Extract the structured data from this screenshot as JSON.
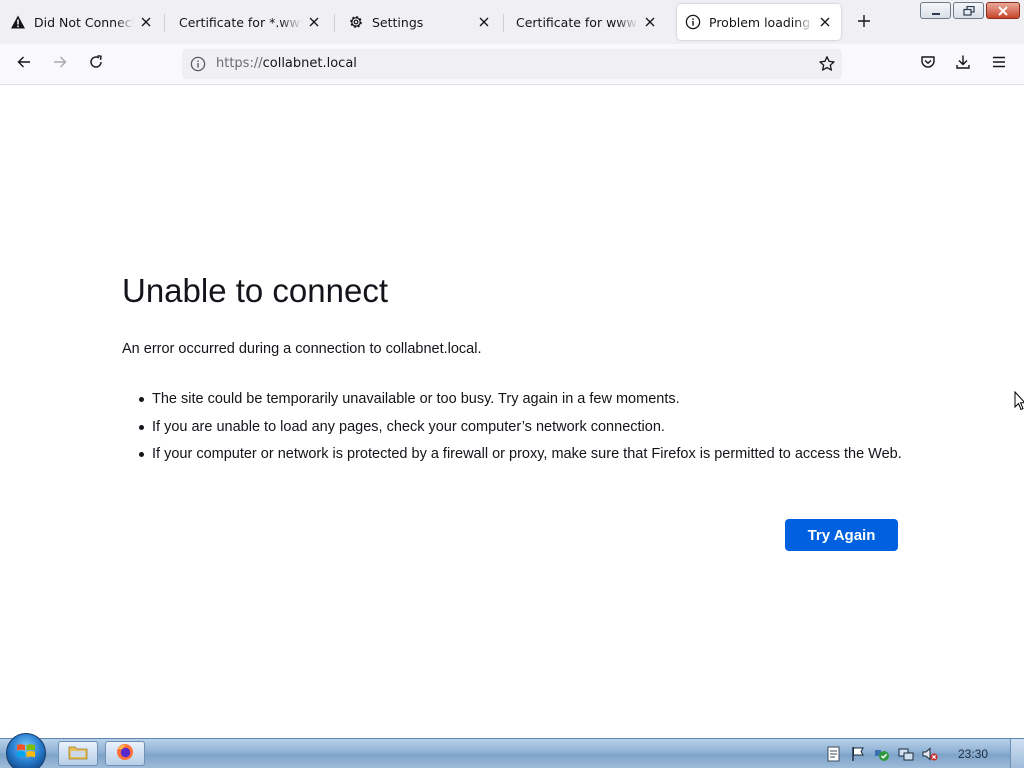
{
  "tabs": [
    {
      "title": "Did Not Connect: Potential Security Issue",
      "icon": "warning-icon",
      "active": false
    },
    {
      "title": "Certificate for *.www.mozilla.org",
      "icon": "none",
      "active": false
    },
    {
      "title": "Settings",
      "icon": "gear-icon",
      "active": false
    },
    {
      "title": "Certificate for www.google.com",
      "icon": "none",
      "active": false
    },
    {
      "title": "Problem loading page",
      "icon": "info-icon",
      "active": true
    }
  ],
  "urlbar": {
    "scheme": "https://",
    "host": "collabnet.local"
  },
  "error_page": {
    "title": "Unable to connect",
    "description": "An error occurred during a connection to collabnet.local.",
    "bullets": [
      "The site could be temporarily unavailable or too busy. Try again in a few moments.",
      "If you are unable to load any pages, check your computer’s network connection.",
      "If your computer or network is protected by a firewall or proxy, make sure that Firefox is permitted to access the Web."
    ],
    "try_again_label": "Try Again"
  },
  "taskbar": {
    "clock": "23:30"
  },
  "colors": {
    "accent": "#0061e0",
    "tabstrip_bg": "#f0f0f4",
    "text": "#15141a"
  }
}
